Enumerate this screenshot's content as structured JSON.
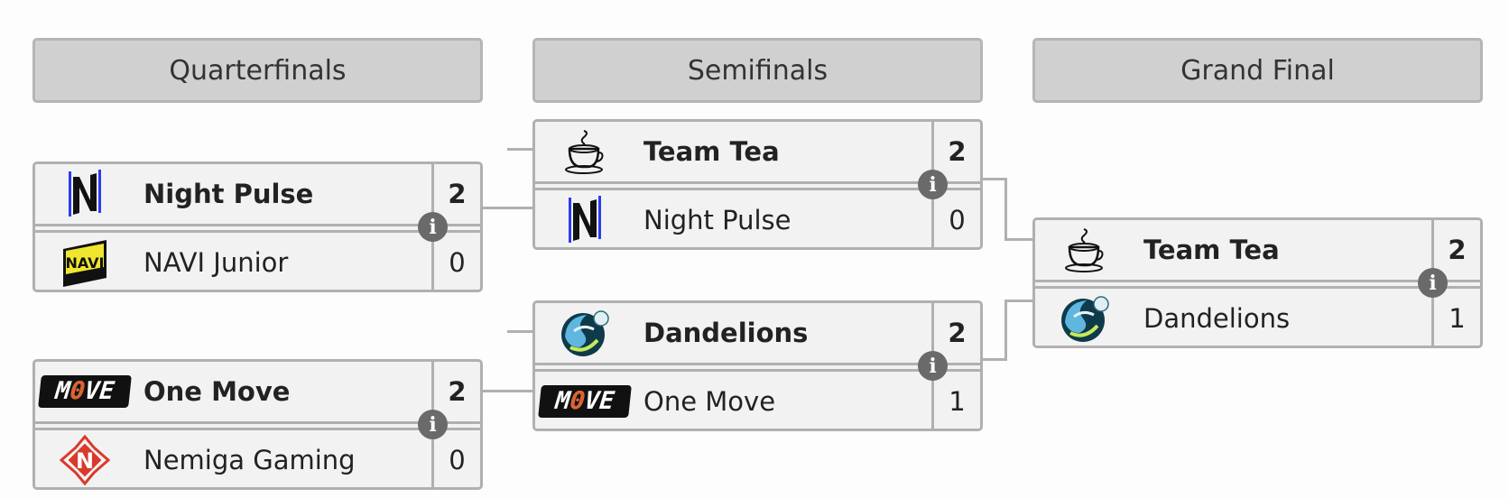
{
  "rounds": [
    {
      "title": "Quarterfinals"
    },
    {
      "title": "Semifinals"
    },
    {
      "title": "Grand Final"
    }
  ],
  "matches": {
    "qf1": {
      "team1": {
        "name": "Night Pulse",
        "score": "2",
        "logo": "night-pulse-logo"
      },
      "team2": {
        "name": "NAVI Junior",
        "score": "0",
        "logo": "navi-junior-logo"
      }
    },
    "qf2": {
      "team1": {
        "name": "One Move",
        "score": "2",
        "logo": "one-move-logo"
      },
      "team2": {
        "name": "Nemiga Gaming",
        "score": "0",
        "logo": "nemiga-logo"
      }
    },
    "sf1": {
      "team1": {
        "name": "Team Tea",
        "score": "2",
        "logo": "team-tea-logo"
      },
      "team2": {
        "name": "Night Pulse",
        "score": "0",
        "logo": "night-pulse-logo"
      }
    },
    "sf2": {
      "team1": {
        "name": "Dandelions",
        "score": "2",
        "logo": "dandelions-logo"
      },
      "team2": {
        "name": "One Move",
        "score": "1",
        "logo": "one-move-logo"
      }
    },
    "gf": {
      "team1": {
        "name": "Team Tea",
        "score": "2",
        "logo": "team-tea-logo"
      },
      "team2": {
        "name": "Dandelions",
        "score": "1",
        "logo": "dandelions-logo"
      }
    }
  },
  "info_icon": "i",
  "move_logo_text": "M0VE",
  "navi_logo_text": "NAVI",
  "colors": {
    "header_bg": "#d0d0d0",
    "match_bg": "#f2f2f2",
    "border": "#b0b0b0",
    "info_bg": "#6a6a6a",
    "move_accent": "#e0612a",
    "navi_yellow": "#f0e630",
    "night_pulse_blue": "#2a3cf0",
    "nemiga_red": "#d93a2b"
  }
}
